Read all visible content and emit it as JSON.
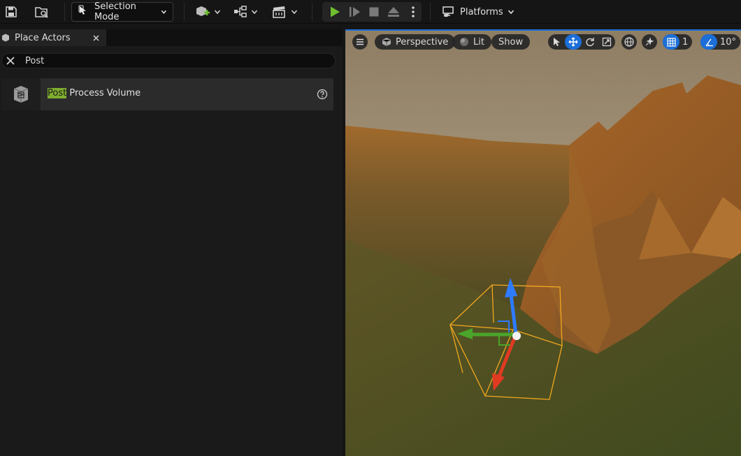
{
  "toolbar": {
    "selection_mode_label": "Selection Mode",
    "platforms_label": "Platforms",
    "icons": [
      "save-icon",
      "content-browser-icon",
      "add-actor-icon",
      "blueprint-icon",
      "cinematics-icon",
      "play-icon",
      "step-icon",
      "stop-icon",
      "eject-icon",
      "more-options-icon",
      "platforms-icon"
    ],
    "play_color": "#6fbf30"
  },
  "place_actors": {
    "tab_title": "Place Actors",
    "search": {
      "value": "Post",
      "placeholder": ""
    },
    "results": [
      {
        "highlight": "Post",
        "rest": " Process Volume",
        "icon": "post-process-volume-icon"
      }
    ],
    "highlight_color": "#7fad2e"
  },
  "viewport": {
    "perspective_label": "Perspective",
    "lit_label": "Lit",
    "show_label": "Show",
    "grid_snap_value": "1",
    "angle_snap_value": "10°",
    "accent_color": "#1c6fd8"
  }
}
